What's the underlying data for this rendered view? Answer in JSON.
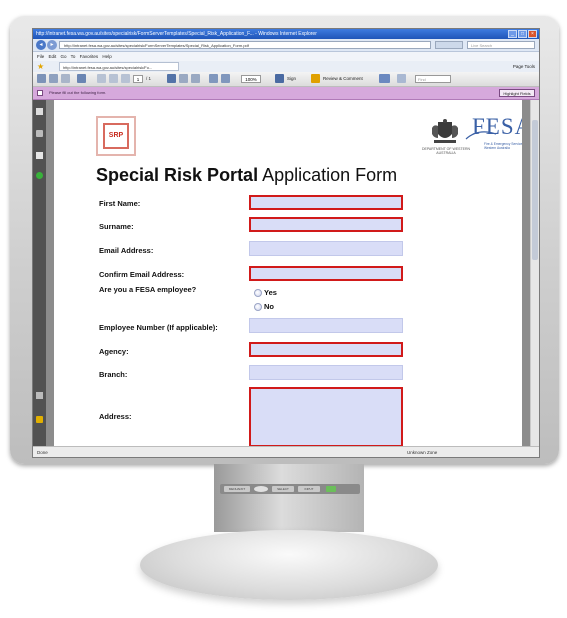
{
  "browser": {
    "title": "http://intranet.fesa.wa.gov.au/sites/specialrisk/FormServerTemplates/Special_Risk_Application_F... - Windows Internet Explorer",
    "address": "http://intranet.fesa.wa.gov.au/sites/specialrisk/FormServerTemplates/Special_Risk_Application_Form.pdf",
    "search_placeholder": "Live Search",
    "menu": "File  Edit  Go To  Favorites  Help",
    "fav_tab": "http://intranet.fesa.wa.gov.au/sites/specialrisk/Fo...",
    "fav_tools": "Page  Tools",
    "status_left": "Done",
    "status_zone": "Unknown Zone"
  },
  "pdf_toolbar": {
    "page_current": "1",
    "page_total": "/ 1",
    "zoom": "100%",
    "sign_label": "Sign",
    "review_label": "Review & Comment",
    "find_placeholder": "Find"
  },
  "notice": {
    "message": "Please fill out the following form.",
    "highlight_button": "Highlight Fields"
  },
  "form": {
    "logo_text": "SRP",
    "title_bold": "Special Risk Portal",
    "title_rest": " Application Form",
    "crest_caption": "DEPARTMENT OF WESTERN AUSTRALIA",
    "fesa_name": "FESA",
    "fesa_sub": "Fire & Emergency Services Authority of Western Australia",
    "labels": {
      "first_name": "First Name:",
      "surname": "Surname:",
      "email": "Email Address:",
      "confirm_email": "Confirm Email Address:",
      "employee_q": "Are you a FESA employee?",
      "yes": "Yes",
      "no": "No",
      "employee_number": "Employee Number (If applicable):",
      "agency": "Agency:",
      "branch": "Branch:",
      "address": "Address:"
    }
  },
  "monitor": {
    "btn1": "MENU/EXIT",
    "btn2": "SELECT",
    "btn3": "INPUT"
  },
  "colors": {
    "required_border": "#d11a1a",
    "field_fill": "#d9ddf7",
    "notice_bar": "#d6a9dc",
    "fesa_blue": "#3a60a6"
  }
}
